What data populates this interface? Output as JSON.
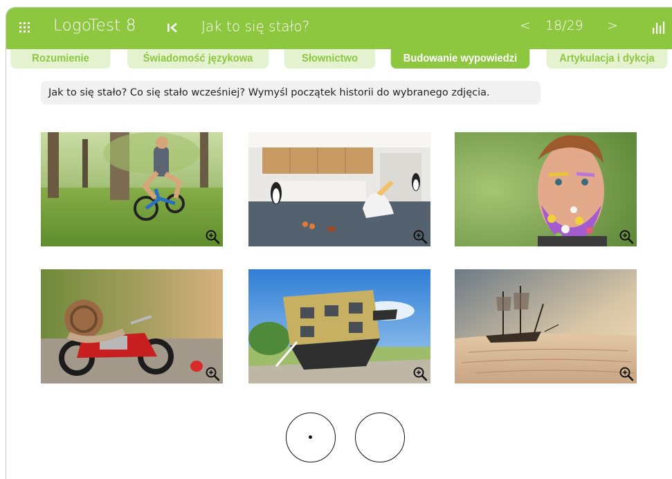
{
  "header": {
    "app_title": "LogoTest 8",
    "task_title": "Jak to się stało?",
    "prev_label": "<",
    "page_counter": "18/29",
    "next_label": ">",
    "background_color": "#8dc63f"
  },
  "tabs": [
    {
      "label": "Rozumienie",
      "active": false
    },
    {
      "label": "Świadomość językowa",
      "active": false
    },
    {
      "label": "Słownictwo",
      "active": false
    },
    {
      "label": "Budowanie wypowiedzi",
      "active": true
    },
    {
      "label": "Artykulacja i dykcja",
      "active": false
    }
  ],
  "instruction": "Jak to się stało? Co się stało wcześniej? Wymyśl początek historii do wybranego zdjęcia.",
  "photos": [
    {
      "subject": "man riding a small child's bicycle in a park"
    },
    {
      "subject": "penguins and a pelican in a flooded kitchen"
    },
    {
      "subject": "man with flowers for beard and eyebrows"
    },
    {
      "subject": "snail riding a toy motorcycle"
    },
    {
      "subject": "upside-down house"
    },
    {
      "subject": "sailing ship stranded in the desert"
    }
  ],
  "icons": {
    "menu": "grid-icon",
    "first_page": "skip-to-first-icon",
    "stats": "bar-chart-icon",
    "zoom": "zoom-in-icon"
  },
  "controls": {
    "answer_circle_1_dot": true,
    "answer_circle_2_dot": false
  }
}
